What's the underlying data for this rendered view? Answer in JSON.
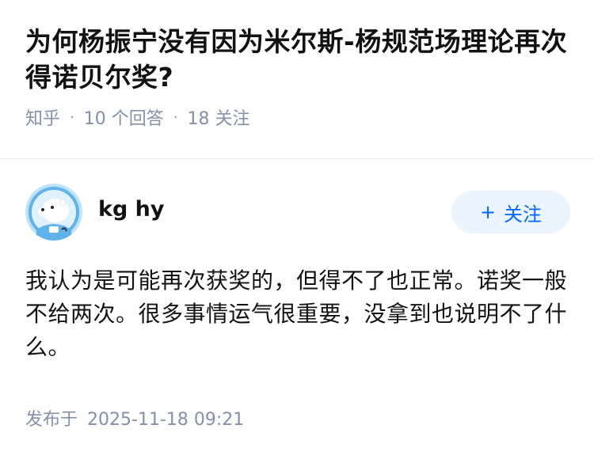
{
  "question": {
    "title": "为何杨振宁没有因为米尔斯-杨规范场理论再次得诺贝尔奖?",
    "source": "知乎",
    "separator": "·",
    "answer_count": "10 个回答",
    "follower_count": "18 关注"
  },
  "answer": {
    "author": {
      "name": "kg hy",
      "avatar_icon": "polar-bear-astronaut-icon"
    },
    "follow_button": {
      "icon": "plus-icon",
      "icon_glyph": "+",
      "label": "关注"
    },
    "content": "我认为是可能再次获奖的，但得不了也正常。诺奖一般不给两次。很多事情运气很重要，没拿到也说明不了什么。",
    "publish_label": "发布于",
    "publish_time": "2025-11-18 09:21"
  },
  "colors": {
    "accent": "#0066ff",
    "button_bg": "#ebf5ff",
    "meta_text": "#8590a6",
    "primary_text": "#121212"
  }
}
